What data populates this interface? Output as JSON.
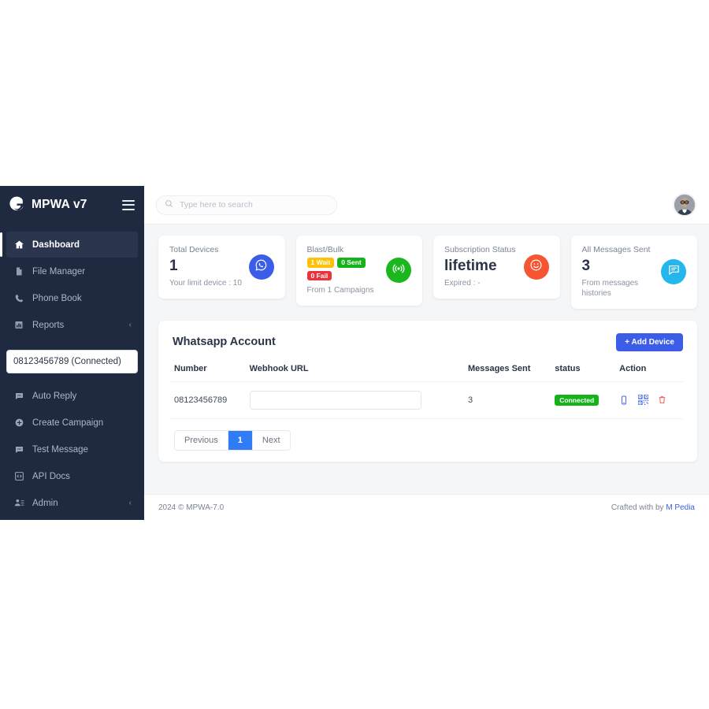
{
  "sidebar": {
    "brand": {
      "name": "MPWA v7",
      "logo_icon": "mpwa-logo-icon",
      "menu_icon": "hamburger-icon"
    },
    "items_top": [
      {
        "label": "Dashboard",
        "icon": "home-icon",
        "active": true,
        "caret": ""
      },
      {
        "label": "File Manager",
        "icon": "file-icon",
        "active": false,
        "caret": ""
      },
      {
        "label": "Phone Book",
        "icon": "phone-icon",
        "active": false,
        "caret": ""
      },
      {
        "label": "Reports",
        "icon": "chart-bar-icon",
        "active": false,
        "caret": "‹"
      }
    ],
    "device_select": {
      "value": "08123456789 (Connected)"
    },
    "items_bottom": [
      {
        "label": "Auto Reply",
        "icon": "comment-dots-icon",
        "active": false,
        "caret": ""
      },
      {
        "label": "Create Campaign",
        "icon": "plus-circle-icon",
        "active": false,
        "caret": ""
      },
      {
        "label": "Test Message",
        "icon": "comment-dots-icon",
        "active": false,
        "caret": ""
      },
      {
        "label": "API Docs",
        "icon": "code-icon",
        "active": false,
        "caret": ""
      },
      {
        "label": "Admin",
        "icon": "user-cog-icon",
        "active": false,
        "caret": "‹"
      }
    ]
  },
  "topbar": {
    "search": {
      "placeholder": "Type here to search",
      "value": "",
      "icon": "search-icon"
    },
    "avatar": {
      "name": "user-avatar"
    }
  },
  "cards": [
    {
      "title": "Total Devices",
      "value": "1",
      "sub": "Your limit device : 10",
      "icon": "whatsapp-icon",
      "icon_color": "#3b5de7"
    },
    {
      "title": "Blast/Bulk",
      "value": "",
      "sub": "From 1 Campaigns",
      "icon": "broadcast-icon",
      "icon_color": "#1bb71f",
      "badges": [
        {
          "label": "1 Wait",
          "color": "#ffc107"
        },
        {
          "label": "0 Sent",
          "color": "#16b21a"
        },
        {
          "label": "0 Fail",
          "color": "#e8343a"
        }
      ]
    },
    {
      "title": "Subscription Status",
      "value": "lifetime",
      "sub": "Expired : -",
      "icon": "smiley-icon",
      "icon_color": "#f75432"
    },
    {
      "title": "All Messages Sent",
      "value": "3",
      "sub": "From messages histories",
      "icon": "chat-icon",
      "icon_color": "#24b6ed"
    }
  ],
  "panel": {
    "title": "Whatsapp Account",
    "add_button": {
      "label": "+  Add Device"
    },
    "columns": [
      "Number",
      "Webhook URL",
      "Messages Sent",
      "status",
      "Action"
    ],
    "rows": [
      {
        "number": "08123456789",
        "webhook_url": "",
        "webhook_placeholder": "",
        "messages_sent": "3",
        "status": "Connected",
        "status_color": "#16b21a",
        "actions": [
          "mobile-phone-icon",
          "qrcode-icon",
          "trash-icon"
        ]
      }
    ],
    "pagination": {
      "previous": "Previous",
      "pages": [
        "1"
      ],
      "next": "Next",
      "current": "1"
    }
  },
  "footer": {
    "left": "2024 © MPWA-7.0",
    "right_prefix": "Crafted with by ",
    "right_link": "M Pedia"
  }
}
